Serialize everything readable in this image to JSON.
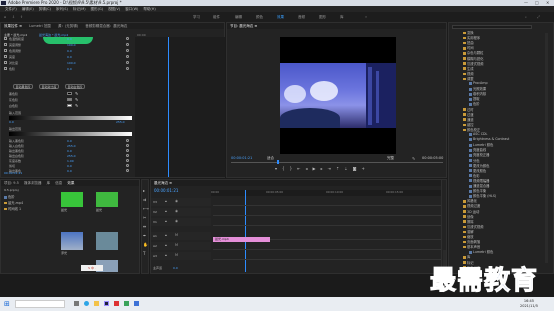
{
  "app": {
    "title": "Adobe Premiere Pro 2020 - D:\\视频\\9\\9.5\\素材\\9.5.prproj *",
    "menu": [
      "文件(F)",
      "编辑(E)",
      "剪辑(C)",
      "序列(S)",
      "标记(M)",
      "图形(G)",
      "视图(V)",
      "窗口(W)",
      "帮助(H)"
    ],
    "workspaces": [
      "学习",
      "组件",
      "编辑",
      "颜色",
      "效果",
      "音频",
      "图形",
      "库"
    ],
    "active_workspace": "效果"
  },
  "effect_controls": {
    "tabs": [
      "效果控件 ≡",
      "Lumetri 范围",
      "源：(无剪辑)",
      "音频剪辑混合器：晨光海边"
    ],
    "source_label": "主要 * 晨光.mp4",
    "seq_label": "晨光海边 * 晨光.mp4",
    "timecode": "00:00",
    "rows": [
      {
        "label": "色温饱和度",
        "value": "0.0"
      },
      {
        "label": "亮度调整",
        "value": "100.0"
      },
      {
        "label": "色调调整",
        "value": "0.0"
      },
      {
        "label": "亮度",
        "value": "0.0"
      },
      {
        "label": "对比度",
        "value": "100.0"
      },
      {
        "label": "色阶",
        "value": "0.0"
      }
    ],
    "buttons": [
      "自动黑色阶",
      "自动对比度",
      "自动白色阶"
    ],
    "picker_rows": [
      "黑色阶",
      "灰色阶",
      "白色阶"
    ],
    "input_label": "输入范围",
    "input_values": [
      "0.0",
      "255.0"
    ],
    "output_label": "输出范围",
    "lower_rows": [
      {
        "label": "输入黑色阶",
        "value": "0.0"
      },
      {
        "label": "输入白色阶",
        "value": "255.0"
      },
      {
        "label": "输出黑色阶",
        "value": "0.0"
      },
      {
        "label": "输出白色阶",
        "value": "255.0"
      },
      {
        "label": "灰度系数",
        "value": "1.00"
      },
      {
        "label": "剪切",
        "value": "0.0"
      },
      {
        "label": "输出黑色",
        "value": "0.0"
      }
    ],
    "bottom_time": "00:00:01:21"
  },
  "program": {
    "tab": "节目: 晨光海边 ≡",
    "timecode": "00:00:01:21",
    "fit": "适合",
    "quality": "完整",
    "duration": "00:00:05:00"
  },
  "project": {
    "tabs": [
      "项目: 9.5",
      "媒体浏览器",
      "库",
      "信息",
      "效果"
    ],
    "path": "9.5.prproj",
    "items": [
      {
        "name": "色阶",
        "type": "fx"
      },
      {
        "name": "晨光.mp4",
        "type": "clip"
      },
      {
        "name": "时间线 1",
        "type": "seq"
      }
    ],
    "thumbs": [
      {
        "label": "晨光",
        "color": "#38c43a"
      },
      {
        "label": "晨光",
        "color": "#3fb93f"
      },
      {
        "label": "浮光",
        "color": "#6a8a9a"
      }
    ]
  },
  "timeline": {
    "tab": "晨光海边 ≡",
    "timecode": "00:00:01:21",
    "ruler": [
      "00:00",
      "00:00:05:00",
      "00:00:10:00",
      "00:00:15:00"
    ],
    "tracks": [
      "V3",
      "V2",
      "V1",
      "A1",
      "A2",
      "A3"
    ],
    "master": "主声道",
    "master_value": "0.0",
    "clip_label": "晨光.mp4"
  },
  "effects_panel": {
    "items": [
      "变换",
      "实用程序",
      "扭曲",
      "时间",
      "杂色与颗粒",
      "模糊与锐化",
      "沉浸式视频",
      "生成",
      "视频",
      "调整",
      "ProcAmp",
      "光照效果",
      "卷积内核",
      "提取",
      "色阶",
      "过时",
      "过渡",
      "通道",
      "键控",
      "颜色校正",
      "ASC CDL",
      "Brightness & Contrast",
      "Lumetri 颜色",
      "亮度曲线",
      "亮度校正器",
      "分色",
      "更改为颜色",
      "更改颜色",
      "色彩",
      "视频限幅器",
      "通道混合器",
      "颜色平衡",
      "颜色平衡 (HLS)",
      "风格化",
      "视频过渡",
      "3D 运动",
      "划像",
      "擦除",
      "沉浸式视频",
      "溶解",
      "缩放",
      "页面剥落",
      "基本声音",
      "Lumetri 颜色",
      "库",
      "标记",
      "历史记录"
    ]
  },
  "taskbar": {
    "time": "16:45",
    "date": "2021/11/5"
  },
  "watermark": "最需教育",
  "colors": {
    "accent": "#3aa0ff",
    "clip": "#e48fd8",
    "playhead": "#2d8cff"
  }
}
